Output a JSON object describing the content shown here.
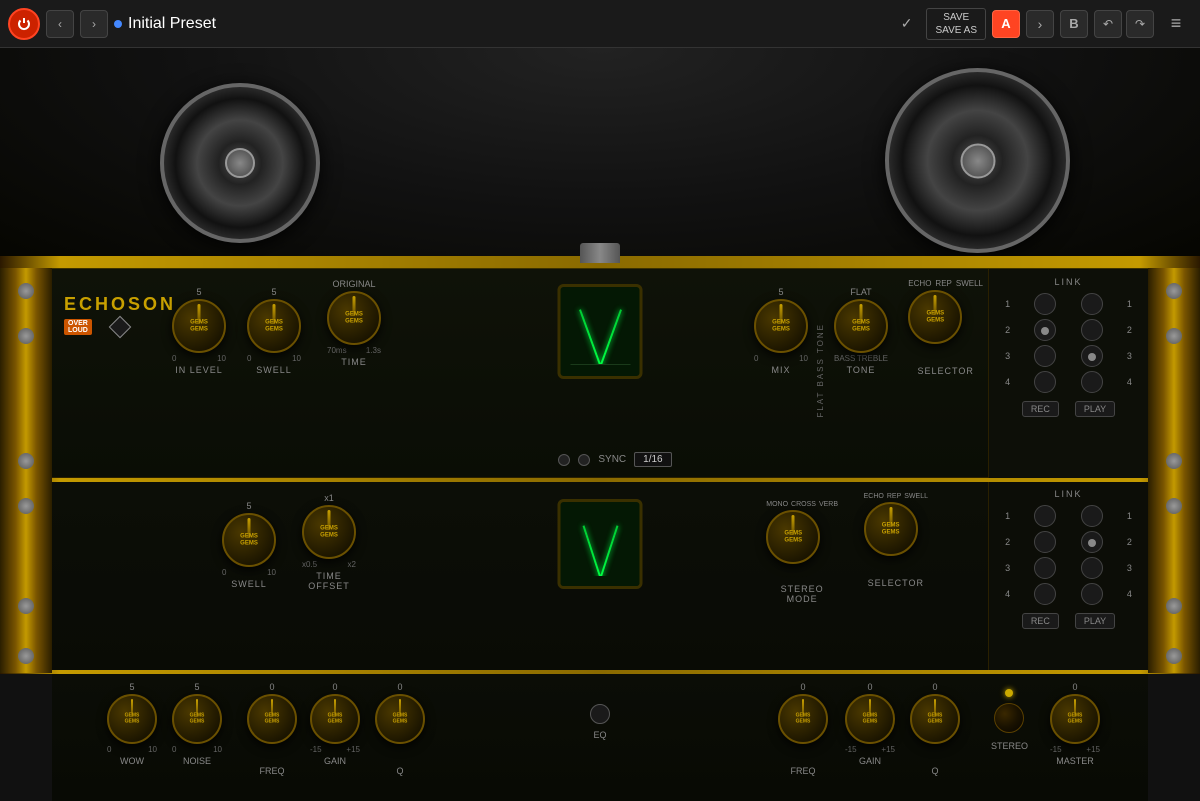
{
  "topbar": {
    "preset_name": "Initial Preset",
    "save_label": "SAVE",
    "save_as_label": "SAVE AS",
    "btn_a": "A",
    "btn_b": "B",
    "menu_icon": "≡"
  },
  "device": {
    "brand": "ECHOSON",
    "overloud": "OVER LOUD"
  },
  "top_section": {
    "in_level_label": "IN LEVEL",
    "in_level_min": "0",
    "in_level_max": "10",
    "in_level_val": "5",
    "swell_label": "SWELL",
    "swell_min": "0",
    "swell_max": "10",
    "swell_val": "5",
    "time_label": "TIME",
    "time_min": "70ms",
    "time_max": "1.3s",
    "time_val": "ORIGINAL",
    "mix_label": "MIX",
    "mix_min": "0",
    "mix_max": "10",
    "mix_val": "5",
    "tone_label": "TONE",
    "tone_min": "BASS",
    "tone_max": "TREBLE",
    "tone_val": "FLAT",
    "selector_label": "SELECTOR",
    "selector_echo": "ECHO",
    "selector_rep": "REP",
    "selector_swell": "SWELL",
    "sync_label": "SYNC",
    "sync_value": "1/16",
    "link_label": "LINK",
    "rec_label": "REC",
    "play_label": "PLAY",
    "numbers": [
      "1",
      "2",
      "3",
      "4"
    ]
  },
  "mid_section": {
    "swell_label": "SWELL",
    "swell_min": "0",
    "swell_max": "10",
    "swell_val": "5",
    "time_offset_label": "TIME\nOFFSET",
    "time_offset_min": "x0.5",
    "time_offset_max": "x2",
    "time_offset_val": "x1",
    "stereo_mode_label": "STEREO\nMODE",
    "stereo_mono": "MONO",
    "stereo_cross": "CROSS",
    "stereo_verb": "VERB",
    "stereo_echo": "ECHO",
    "stereo_rep": "REP",
    "stereo_swell": "SWELL",
    "selector_label": "SELECTOR",
    "link_label": "LINK",
    "rec_label": "REC",
    "play_label": "PLAY",
    "numbers": [
      "1",
      "2",
      "3",
      "4"
    ]
  },
  "bot_section": {
    "wow_label": "WOW",
    "wow_val": "5",
    "wow_min": "0",
    "wow_max": "10",
    "noise_label": "NOISE",
    "noise_val": "5",
    "noise_min": "0",
    "noise_max": "10",
    "eq1_freq_label": "FREQ",
    "eq1_freq_val": "0",
    "eq1_gain_label": "GAIN",
    "eq1_gain_min": "-15",
    "eq1_gain_max": "+15",
    "eq1_gain_val": "0",
    "eq1_q_label": "Q",
    "eq1_q_val": "0",
    "eq_label": "EQ",
    "eq2_freq_label": "FREQ",
    "eq2_freq_val": "0",
    "eq2_gain_label": "GAIN",
    "eq2_gain_min": "-15",
    "eq2_gain_max": "+15",
    "eq2_gain_val": "0",
    "eq2_q_label": "Q",
    "eq2_q_val": "0",
    "stereo_label": "STEREO",
    "master_label": "MASTER",
    "master_min": "-15",
    "master_max": "+15",
    "master_val": "0"
  },
  "flat_bass_tone": "FLAT BASS TONE"
}
